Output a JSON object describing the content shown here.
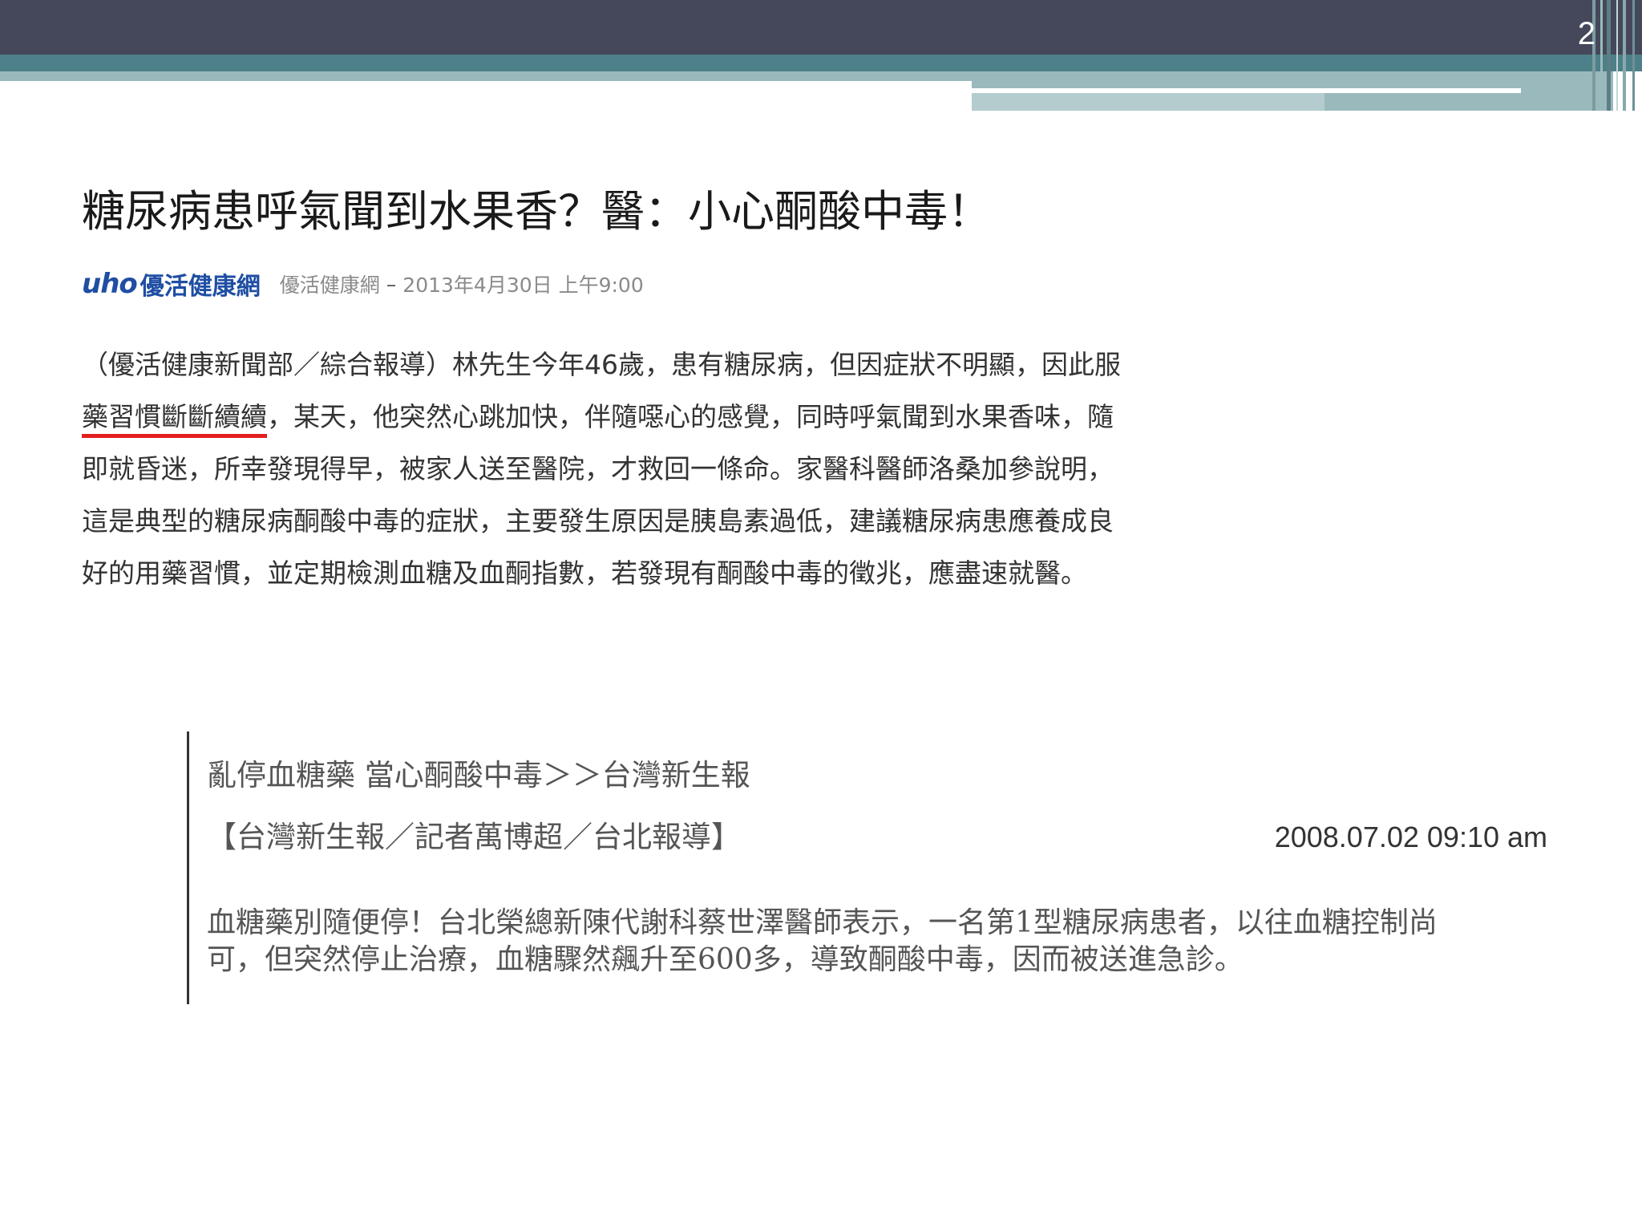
{
  "slide": {
    "number": "2",
    "colors": {
      "header_dark": "#45485a",
      "header_teal": "#4d8088",
      "header_light": "#9ab9bd",
      "highlight_underline": "#e31e1e",
      "logo_blue": "#1f4ea3"
    }
  },
  "article1": {
    "title": "糖尿病患呼氣聞到水果香？醫：小心酮酸中毒！",
    "byline": {
      "logo_mark": "uho",
      "logo_text": "優活健康網",
      "source": "優活健康網",
      "separator": "–",
      "date": "2013年4月30日 上午9:00"
    },
    "body": {
      "line1": "（優活健康新聞部／綜合報導）林先生今年46歲，患有糖尿病，但因症狀不明顯，因此服",
      "line2_highlight": "藥習慣斷斷續續",
      "line2_rest": "，某天，他突然心跳加快，伴隨噁心的感覺，同時呼氣聞到水果香味，隨",
      "line3": "即就昏迷，所幸發現得早，被家人送至醫院，才救回一條命。家醫科醫師洛桑加參說明，",
      "line4": "這是典型的糖尿病酮酸中毒的症狀，主要發生原因是胰島素過低，建議糖尿病患應養成良",
      "line5": "好的用藥習慣，並定期檢測血糖及血酮指數，若發現有酮酸中毒的徵兆，應盡速就醫。"
    }
  },
  "article2": {
    "title": "亂停血糖藥 當心酮酸中毒＞＞台灣新生報",
    "reporter": "【台灣新生報／記者萬博超／台北報導】",
    "timestamp": "2008.07.02 09:10 am",
    "body": {
      "line1": "血糖藥別隨便停！台北榮總新陳代謝科蔡世澤醫師表示，一名第1型糖尿病患者，以往血糖控制尚",
      "line2": "可，但突然停止治療，血糖驟然飆升至600多，導致酮酸中毒，因而被送進急診。"
    }
  }
}
